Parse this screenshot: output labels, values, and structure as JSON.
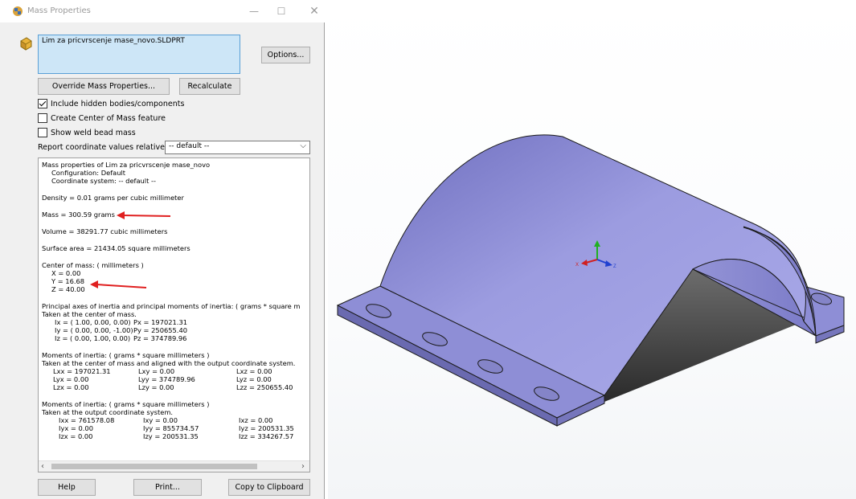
{
  "window": {
    "title": "Mass Properties",
    "minimize_glyph": "—",
    "maximize_glyph": "☐",
    "close_glyph": "✕"
  },
  "selection": {
    "text": "Lim za pricvrscenje mase_novo.SLDPRT"
  },
  "buttons": {
    "options": "Options...",
    "override": "Override Mass Properties...",
    "recalculate": "Recalculate",
    "help": "Help",
    "print": "Print...",
    "copy": "Copy to Clipboard"
  },
  "checkboxes": {
    "include_hidden": {
      "label": "Include hidden bodies/components",
      "checked": true
    },
    "create_com": {
      "label": "Create Center of Mass feature",
      "checked": false
    },
    "show_weld": {
      "label": "Show weld bead mass",
      "checked": false
    }
  },
  "report": {
    "label": "Report coordinate values relative to:",
    "value": "-- default --"
  },
  "results": {
    "header": "Mass properties of Lim za pricvrscenje mase_novo",
    "configuration": "Configuration: Default",
    "coordinate_system": "Coordinate system: -- default --",
    "density": "Density = 0.01 grams per cubic millimeter",
    "mass": "Mass = 300.59 grams",
    "volume": "Volume = 38291.77 cubic millimeters",
    "surface_area": "Surface area = 21434.05  square millimeters",
    "com_header": "Center of mass: ( millimeters )",
    "com_x": "X = 0.00",
    "com_y": "Y = 16.68",
    "com_z": "Z = 40.00",
    "principal_header": "Principal axes of inertia and principal moments of inertia: ( grams *  square m",
    "principal_taken": "Taken at the center of mass.",
    "principal_rows": [
      [
        "Ix = ( 1.00,  0.00,  0.00)",
        "Px = 197021.31"
      ],
      [
        "Iy = ( 0.00,  0.00, -1.00)",
        "Py = 250655.40"
      ],
      [
        "Iz = ( 0.00,  1.00,  0.00)",
        "Pz = 374789.96"
      ]
    ],
    "moments_header": "Moments of inertia: ( grams *  square millimeters )",
    "moments_com_taken": "Taken at the center of mass and aligned with the output coordinate system.",
    "moments_com_rows": [
      [
        "Lxx = 197021.31",
        "Lxy = 0.00",
        "Lxz = 0.00"
      ],
      [
        "Lyx = 0.00",
        "Lyy = 374789.96",
        "Lyz = 0.00"
      ],
      [
        "Lzx = 0.00",
        "Lzy = 0.00",
        "Lzz = 250655.40"
      ]
    ],
    "moments_out_header": "Moments of inertia: ( grams *  square millimeters )",
    "moments_out_taken": "Taken at the output coordinate system.",
    "moments_out_rows": [
      [
        "Ixx = 761578.08",
        "Ixy = 0.00",
        "Ixz = 0.00"
      ],
      [
        "Iyx = 0.00",
        "Iyy = 855734.57",
        "Iyz = 200531.35"
      ],
      [
        "Izx = 0.00",
        "Izy = 200531.35",
        "Izz = 334267.57"
      ]
    ]
  },
  "triad": {
    "x_label": "X",
    "z_label": "Z"
  },
  "colors": {
    "arrow": "#e02020",
    "part_fill": "#8e8ed6",
    "triad_x": "#d02020",
    "triad_y": "#20b020",
    "triad_z": "#2040d0"
  }
}
